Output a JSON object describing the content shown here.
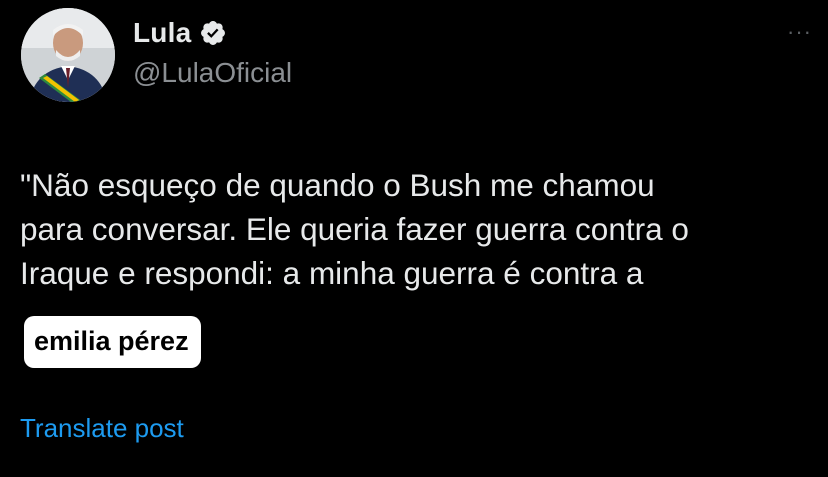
{
  "author": {
    "display_name": "Lula",
    "handle": "@LulaOficial",
    "verified": true,
    "avatar_icon": "profile-photo"
  },
  "tweet": {
    "text": "\"Não esqueço de quando o Bush me chamou\npara conversar. Ele queria fazer guerra contra o\nIraque e respondi: a minha guerra é contra a",
    "sticker_text": "emilia pérez"
  },
  "actions": {
    "more_icon": "···",
    "translate_label": "Translate post"
  },
  "colors": {
    "background": "#000000",
    "text": "#e7e9ea",
    "secondary": "#8b8f93",
    "link": "#1d9bf0",
    "verified_badge": "#e7e9ea"
  }
}
